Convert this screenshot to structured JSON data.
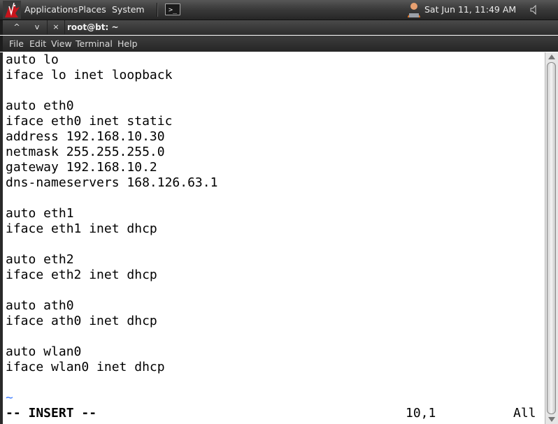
{
  "panel": {
    "menus": [
      "Applications",
      "Places",
      "System"
    ],
    "launcher_icon": "terminal-icon",
    "launcher_glyph": ">_",
    "clock": "Sat Jun 11, 11:49 AM",
    "user_icon": "user-icon",
    "volume_icon": "volume-icon"
  },
  "window": {
    "title": "root@bt: ~",
    "buttons": {
      "minimize": "^",
      "maximize": "v",
      "close": "×"
    },
    "menu": [
      "File",
      "Edit",
      "View",
      "Terminal",
      "Help"
    ]
  },
  "editor": {
    "lines": [
      "auto lo",
      "iface lo inet loopback",
      "",
      "auto eth0",
      "iface eth0 inet static",
      "address 192.168.10.30",
      "netmask 255.255.255.0",
      "gateway 192.168.10.2",
      "dns-nameservers 168.126.63.1",
      "",
      "auto eth1",
      "iface eth1 inet dhcp",
      "",
      "auto eth2",
      "iface eth2 inet dhcp",
      "",
      "auto ath0",
      "iface ath0 inet dhcp",
      "",
      "auto wlan0",
      "iface wlan0 inet dhcp"
    ],
    "empty_marker": "~",
    "mode": "-- INSERT --",
    "cursor_position": "10,1",
    "scroll_percent": "All"
  },
  "colors": {
    "panel": "#3b3b3b",
    "terminal_bg": "#ffffff",
    "text": "#000000",
    "tilde": "#3b7bff"
  }
}
